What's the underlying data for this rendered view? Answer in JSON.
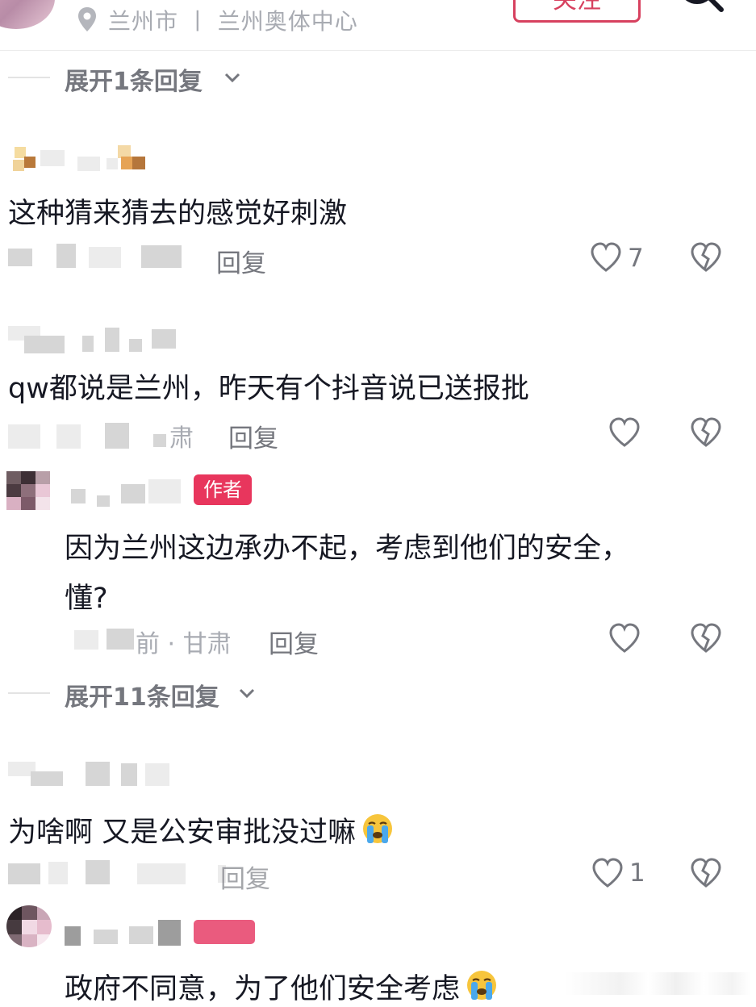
{
  "header": {
    "location": "兰州市 丨 兰州奥体中心",
    "follow_label": "关注"
  },
  "expand_1": {
    "label": "展开1条回复"
  },
  "expand_2": {
    "label": "展开11条回复"
  },
  "comments": [
    {
      "text": "这种猜来猜去的感觉好刺激",
      "meta": "",
      "reply_label": "回复",
      "likes": "7"
    },
    {
      "text": "qw都说是兰州，昨天有个抖音说已送报批",
      "meta": "肃",
      "reply_label": "回复",
      "likes": ""
    },
    {
      "author_tag": "作者",
      "text_line1": "因为兰州这边承办不起，考虑到他们的安全，",
      "text_line2": "懂?",
      "meta": "前 · 甘肃",
      "reply_label": "回复",
      "likes": ""
    },
    {
      "text": "为啥啊 又是公安审批没过嘛",
      "meta": "",
      "reply_label": "回复",
      "likes": "1"
    },
    {
      "text": "政府不同意，为了他们安全考虑"
    }
  ],
  "icons": {
    "location": "location-pin-icon",
    "search": "search-icon",
    "like": "heart-outline-icon",
    "dislike": "broken-heart-icon",
    "emoji": "crying-face-emoji"
  },
  "colors": {
    "accent": "#e8365d",
    "text": "#161823",
    "muted": "#a8abb2"
  }
}
